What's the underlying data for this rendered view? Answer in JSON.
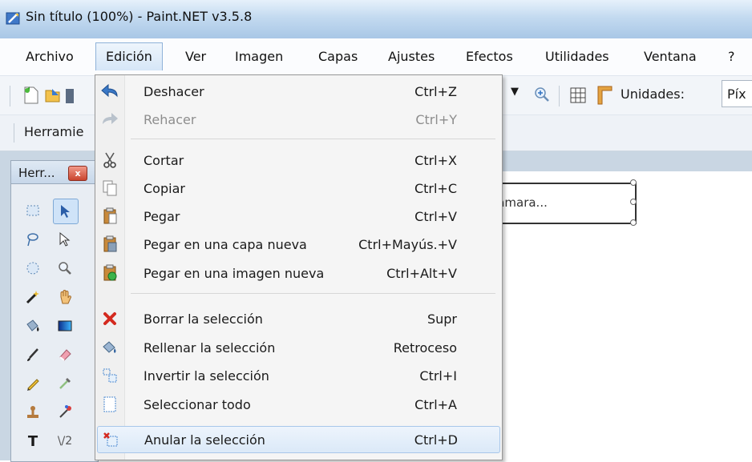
{
  "window": {
    "title": "Sin título (100%) - Paint.NET v3.5.8"
  },
  "menubar": {
    "items": [
      "Archivo",
      "Edición",
      "Ver",
      "Imagen",
      "Capas",
      "Ajustes",
      "Efectos",
      "Utilidades",
      "Ventana",
      "?"
    ],
    "active": "Edición"
  },
  "toolbar": {
    "units_label": "Unidades:",
    "units_value": "Píx"
  },
  "toolbar2": {
    "label": "Herramie"
  },
  "tools_window": {
    "title": "Herr..."
  },
  "canvas": {
    "text_placeholder": "o cámara..."
  },
  "edit_menu": {
    "items": [
      {
        "label": "Deshacer",
        "shortcut": "Ctrl+Z",
        "icon": "undo-icon",
        "enabled": true
      },
      {
        "label": "Rehacer",
        "shortcut": "Ctrl+Y",
        "icon": "redo-icon",
        "enabled": false
      },
      {
        "label": "Cortar",
        "shortcut": "Ctrl+X",
        "icon": "scissors-icon",
        "enabled": true
      },
      {
        "label": "Copiar",
        "shortcut": "Ctrl+C",
        "icon": "copy-icon",
        "enabled": true
      },
      {
        "label": "Pegar",
        "shortcut": "Ctrl+V",
        "icon": "paste-icon",
        "enabled": true
      },
      {
        "label": "Pegar en una capa nueva",
        "shortcut": "Ctrl+Mayús.+V",
        "icon": "paste-layer-icon",
        "enabled": true
      },
      {
        "label": "Pegar en una imagen nueva",
        "shortcut": "Ctrl+Alt+V",
        "icon": "paste-image-icon",
        "enabled": true
      },
      {
        "label": "Borrar la selección",
        "shortcut": "Supr",
        "icon": "delete-x-icon",
        "enabled": true
      },
      {
        "label": "Rellenar la selección",
        "shortcut": "Retroceso",
        "icon": "fill-bucket-icon",
        "enabled": true
      },
      {
        "label": "Invertir la selección",
        "shortcut": "Ctrl+I",
        "icon": "invert-selection-icon",
        "enabled": true
      },
      {
        "label": "Seleccionar todo",
        "shortcut": "Ctrl+A",
        "icon": "select-all-icon",
        "enabled": true
      },
      {
        "label": "Anular la selección",
        "shortcut": "Ctrl+D",
        "icon": "deselect-icon",
        "enabled": true,
        "highlighted": true
      }
    ]
  },
  "colors": {
    "accent": "#3d7bc7",
    "menu_highlight": "#dbe9f8",
    "delete_red": "#d42a1f"
  }
}
